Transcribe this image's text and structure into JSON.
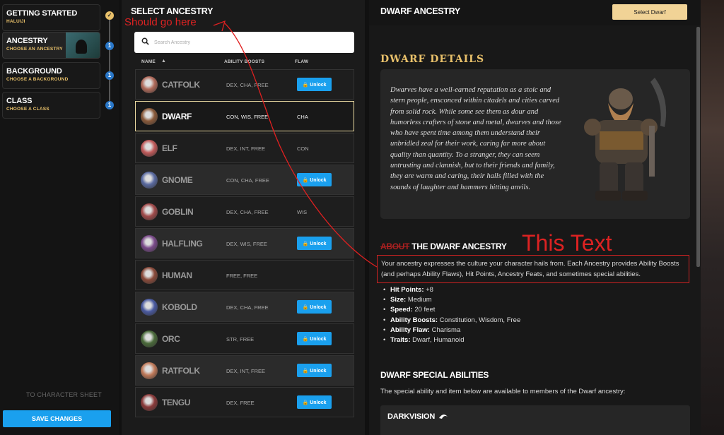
{
  "steps": [
    {
      "title": "GETTING STARTED",
      "sub": "HALUIJI",
      "badge": "✓"
    },
    {
      "title": "ANCESTRY",
      "sub": "CHOOSE AN ANCESTRY",
      "badge": "1"
    },
    {
      "title": "BACKGROUND",
      "sub": "CHOOSE A BACKGROUND",
      "badge": "1"
    },
    {
      "title": "CLASS",
      "sub": "CHOOSE A CLASS",
      "badge": "1"
    }
  ],
  "sidebar": {
    "to_sheet": "TO CHARACTER SHEET",
    "save_label": "SAVE CHANGES"
  },
  "ancestry_list": {
    "title": "SELECT ANCESTRY",
    "search_placeholder": "Search Ancestry",
    "col_name": "NAME",
    "col_boosts": "ABILITY BOOSTS",
    "col_flaw": "FLAW",
    "unlock_label": "Unlock",
    "rows": [
      {
        "name": "CATFOLK",
        "boosts": "DEX, CHA, FREE",
        "flaw": "",
        "locked": true,
        "color": "#b06a5a"
      },
      {
        "name": "DWARF",
        "boosts": "CON, WIS, FREE",
        "flaw": "CHA",
        "locked": false,
        "color": "#8a5a3a"
      },
      {
        "name": "ELF",
        "boosts": "DEX, INT, FREE",
        "flaw": "CON",
        "locked": false,
        "color": "#c05a5a"
      },
      {
        "name": "GNOME",
        "boosts": "CON, CHA, FREE",
        "flaw": "",
        "locked": true,
        "color": "#5a6aa0"
      },
      {
        "name": "GOBLIN",
        "boosts": "DEX, CHA, FREE",
        "flaw": "WIS",
        "locked": false,
        "color": "#a04a4a"
      },
      {
        "name": "HALFLING",
        "boosts": "DEX, WIS, FREE",
        "flaw": "",
        "locked": true,
        "color": "#7a4a8a"
      },
      {
        "name": "HUMAN",
        "boosts": "FREE, FREE",
        "flaw": "",
        "locked": false,
        "color": "#8a4a3a"
      },
      {
        "name": "KOBOLD",
        "boosts": "DEX, CHA, FREE",
        "flaw": "",
        "locked": true,
        "color": "#4a5aa0"
      },
      {
        "name": "ORC",
        "boosts": "STR, FREE",
        "flaw": "",
        "locked": true,
        "color": "#4a6a3a"
      },
      {
        "name": "RATFOLK",
        "boosts": "DEX, INT, FREE",
        "flaw": "",
        "locked": true,
        "color": "#c07a5a"
      },
      {
        "name": "TENGU",
        "boosts": "DEX, FREE",
        "flaw": "",
        "locked": true,
        "color": "#8a3a3a"
      }
    ]
  },
  "detail": {
    "title": "DWARF ANCESTRY",
    "select_label": "Select Dwarf",
    "details_heading": "DWARF DETAILS",
    "lore": "Dwarves have a well-earned reputation as a stoic and stern people, ensconced within citadels and cities carved from solid rock. While some see them as dour and humorless crafters of stone and metal, dwarves and those who have spent time among them understand their unbridled zeal for their work, caring far more about quality than quantity. To a stranger, they can seem untrusting and clannish, but to their friends and family, they are warm and caring, their halls filled with the sounds of laughter and hammers hitting anvils.",
    "about_strike": "ABOUT",
    "about_heading": " THE DWARF ANCESTRY",
    "about_text": "Your ancestry expresses the culture your character hails from. Each Ancestry provides Ability Boosts (and perhaps Ability Flaws), Hit Points, Ancestry Feats, and sometimes special abilities.",
    "facts": [
      {
        "label": "Hit Points:",
        "value": " +8"
      },
      {
        "label": "Size:",
        "value": " Medium"
      },
      {
        "label": "Speed:",
        "value": " 20 feet"
      },
      {
        "label": "Ability Boosts:",
        "value": " Constitution, Wisdom, Free"
      },
      {
        "label": "Ability Flaw:",
        "value": " Charisma"
      },
      {
        "label": "Traits:",
        "value": " Dwarf, Humanoid"
      }
    ],
    "special_heading": "DWARF SPECIAL ABILITIES",
    "special_text": "The special ability and item below are available to members of the Dwarf ancestry:",
    "darkvision": "DARKVISION"
  },
  "annotations": {
    "small": "Should go here",
    "big": "This Text"
  },
  "colors": {
    "accent": "#1aa0ee",
    "gold": "#e8c06a",
    "annotation": "#dd2222"
  }
}
